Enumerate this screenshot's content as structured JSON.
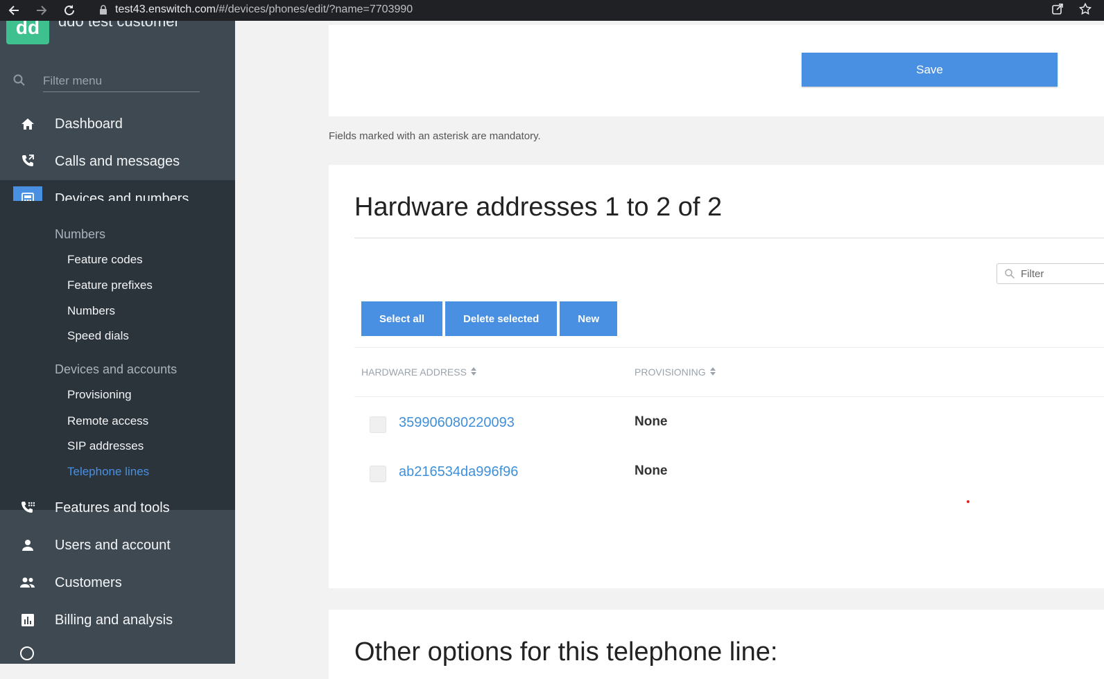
{
  "browser": {
    "url_host": "test43.enswitch.com",
    "url_path": "/#/devices/phones/edit/?name=7703990"
  },
  "sidebar": {
    "brand_initials": "dd",
    "brand_name": "ddo test customer",
    "filter_placeholder": "Filter menu",
    "items": [
      {
        "label": "Dashboard",
        "icon": "home-icon"
      },
      {
        "label": "Calls and messages",
        "icon": "phone-call-icon"
      },
      {
        "label": "Devices and numbers",
        "icon": "calculator-icon"
      },
      {
        "label": "Features and tools",
        "icon": "phone-dialpad-icon"
      },
      {
        "label": "Users and account",
        "icon": "user-icon"
      },
      {
        "label": "Customers",
        "icon": "people-icon"
      },
      {
        "label": "Billing and analysis",
        "icon": "bar-chart-icon"
      }
    ],
    "submenu": {
      "numbers_heading": "Numbers",
      "numbers_items": [
        "Feature codes",
        "Feature prefixes",
        "Numbers",
        "Speed dials"
      ],
      "devices_heading": "Devices and accounts",
      "devices_items": [
        "Provisioning",
        "Remote access",
        "SIP addresses",
        "Telephone lines"
      ]
    }
  },
  "main": {
    "save_label": "Save",
    "mandatory_note": "Fields marked with an asterisk are mandatory.",
    "hw_title": "Hardware addresses 1 to 2 of 2",
    "filter_placeholder": "Filter",
    "actions": {
      "select_all": "Select all",
      "delete_selected": "Delete selected",
      "new": "New"
    },
    "columns": {
      "hardware_address": "HARDWARE ADDRESS",
      "provisioning": "PROVISIONING"
    },
    "rows": [
      {
        "address": "359906080220093",
        "provisioning": "None"
      },
      {
        "address": "ab216534da996f96",
        "provisioning": "None"
      }
    ],
    "other_title": "Other options for this telephone line:"
  },
  "colors": {
    "accent": "#4a90e2",
    "sidebar_bg": "#3e4952",
    "sidebar_active_bg": "#2b333b",
    "brand": "#3fc08f"
  }
}
